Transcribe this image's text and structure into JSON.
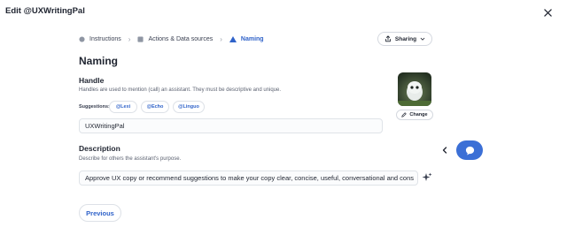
{
  "window": {
    "title": "Edit @UXWritingPal"
  },
  "steps": [
    {
      "label": "Instructions"
    },
    {
      "label": "Actions & Data sources"
    },
    {
      "label": "Naming"
    }
  ],
  "sharing": {
    "label": "Sharing"
  },
  "page": {
    "title": "Naming"
  },
  "handle": {
    "heading": "Handle",
    "help": "Handles are used to mention (call) an assistant. They must be descriptive and unique.",
    "suggestions_label": "Suggestions:",
    "suggestions": [
      "@Lexi",
      "@Echo",
      "@Linguo"
    ],
    "value": "UXWritingPal"
  },
  "avatar": {
    "change_label": "Change"
  },
  "description": {
    "heading": "Description",
    "help": "Describe for others the assistant's purpose.",
    "value": "Approve UX copy or recommend suggestions to make your copy clear, concise, useful, conversational and cons"
  },
  "footer": {
    "previous_label": "Previous"
  },
  "colors": {
    "accent": "#3b6fd6",
    "link": "#2f62c9"
  }
}
